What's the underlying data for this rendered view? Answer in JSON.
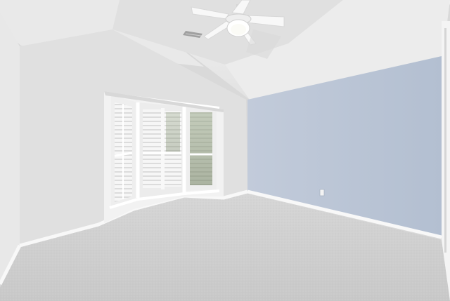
{
  "scene": {
    "kind": "empty-room-photo",
    "elements": [
      "vaulted-ceiling",
      "ceiling-fan",
      "air-vent",
      "bay-window",
      "plantation-shutters",
      "blue-accent-wall",
      "white-baseboards",
      "carpet-floor",
      "wall-outlet",
      "door-edge"
    ]
  },
  "colors": {
    "ceiling": "#ececec",
    "left_wall": "#e6e6e6",
    "back_wall": "#dedede",
    "accent_wall": "#b9c4d4",
    "carpet": "#cfcfcf",
    "baseboard": "#f7f7f7",
    "trim": "#f4f4f4",
    "foliage": "#7d8c66"
  }
}
